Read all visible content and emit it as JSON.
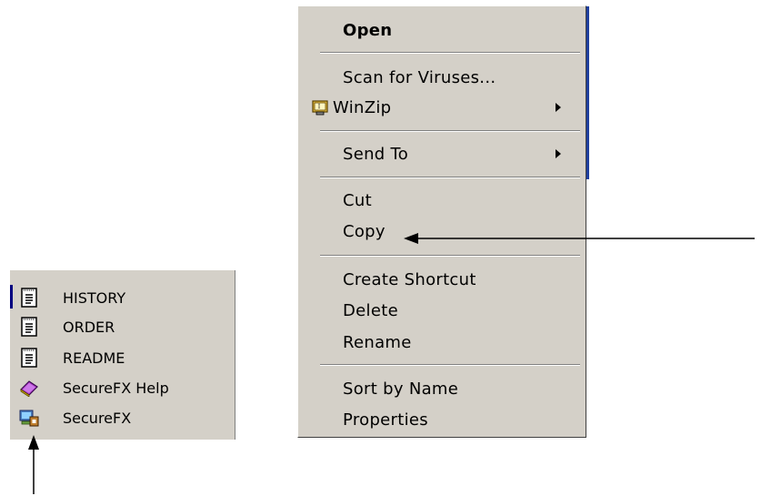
{
  "left_menu": {
    "items": [
      {
        "label": "HISTORY",
        "icon": "text-document-icon"
      },
      {
        "label": "ORDER",
        "icon": "text-document-icon"
      },
      {
        "label": "README",
        "icon": "text-document-icon"
      },
      {
        "label": "SecureFX Help",
        "icon": "help-book-icon"
      },
      {
        "label": "SecureFX",
        "icon": "securefx-app-icon"
      }
    ]
  },
  "context_menu": {
    "open": "Open",
    "scan": "Scan for Viruses...",
    "winzip": "WinZip",
    "send_to": "Send To",
    "cut": "Cut",
    "copy": "Copy",
    "create_shortcut": "Create Shortcut",
    "delete": "Delete",
    "rename": "Rename",
    "sort_by_name": "Sort by Name",
    "properties": "Properties"
  },
  "colors": {
    "menu_bg": "#d4d0c8",
    "highlight_edge": "#1f3f9f"
  }
}
